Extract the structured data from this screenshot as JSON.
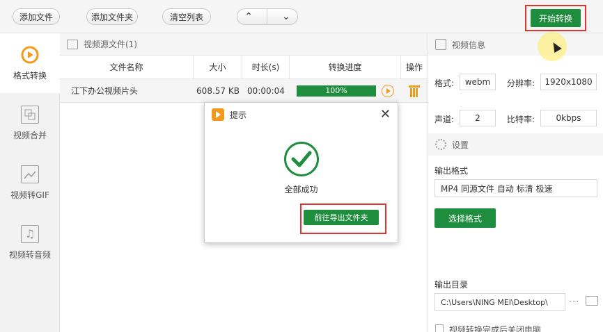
{
  "toolbar": {
    "add_file": "添加文件",
    "add_folder": "添加文件夹",
    "clear_list": "清空列表",
    "start_convert": "开始转换"
  },
  "nav": [
    {
      "label": "格式转换",
      "icon": "format-convert-icon"
    },
    {
      "label": "视频合并",
      "icon": "video-merge-icon"
    },
    {
      "label": "视频转GIF",
      "icon": "gif-icon"
    },
    {
      "label": "视频转音频",
      "icon": "audio-icon"
    }
  ],
  "files": {
    "header": "视频源文件(1)",
    "columns": [
      "文件名称",
      "大小",
      "时长(s)",
      "转换进度",
      "操作"
    ],
    "rows": [
      {
        "name": "江下办公视频片头",
        "size": "608.57 KB",
        "duration": "00:00:04",
        "progress": "100%"
      }
    ]
  },
  "info": {
    "header": "视频信息",
    "format_label": "格式:",
    "format_value": "webm",
    "resolution_label": "分辨率:",
    "resolution_value": "1920x1080",
    "channel_label": "声道:",
    "channel_value": "2",
    "bitrate_label": "比特率:",
    "bitrate_value": "0kbps"
  },
  "settings": {
    "header": "设置",
    "output_format_label": "输出格式",
    "output_format_value": "MP4 同源文件 自动 标清 极速",
    "select_format": "选择格式",
    "output_dir_label": "输出目录",
    "output_dir_value": "C:\\Users\\NING MEI\\Desktop\\",
    "shutdown_label": "视频转换完成后关闭电脑"
  },
  "dialog": {
    "title": "提示",
    "message": "全部成功",
    "button": "前往导出文件夹"
  },
  "colors": {
    "green": "#1e8e3e",
    "orange": "#f39a1e",
    "red_highlight": "#e0342f"
  }
}
